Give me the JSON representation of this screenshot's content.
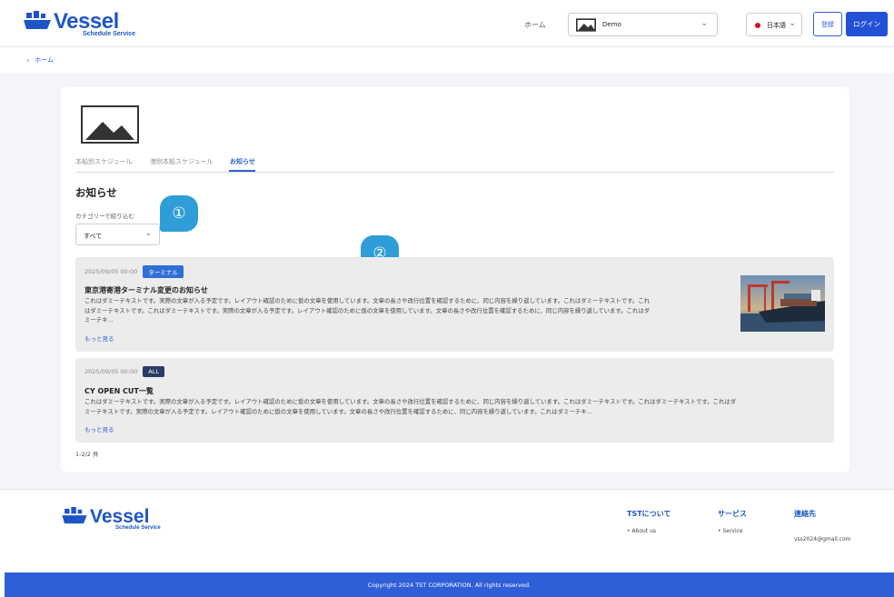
{
  "header": {
    "logo": {
      "title": "Vessel",
      "subtitle": "Schedule Service"
    },
    "nav_home": "ホーム",
    "company_select": {
      "value": "Demo"
    },
    "language_select": {
      "value": "日本語"
    },
    "register_label": "登録",
    "login_label": "ログイン"
  },
  "breadcrumb": {
    "back_icon": "chevron-left-icon",
    "label": "ホーム"
  },
  "tabs": [
    {
      "label": "本船別スケジュール",
      "active": false
    },
    {
      "label": "港別本船スケジュール",
      "active": false
    },
    {
      "label": "お知らせ",
      "active": true
    }
  ],
  "section": {
    "title": "お知らせ",
    "filter_label": "カテゴリーで絞り込む",
    "filter_value": "すべて"
  },
  "callouts": [
    "①",
    "②"
  ],
  "notices": [
    {
      "date": "2025/09/05 00:00",
      "badge": "ターミナル",
      "badge_color": "#2f6fd6",
      "title": "東京港寄港ターミナル変更のお知らせ",
      "body_lines": [
        "これはダミーテキストです。実際の文章が入る予定です。レイアウト確認のために仮の文章を使用しています。文章の長さや改行位置を確認するために、同じ内容を繰り返しています。これはダミーテキストです。これ",
        "はダミーテキストです。これはダミーテキストです。実際の文章が入る予定です。レイアウト確認のために仮の文章を使用しています。文章の長さや改行位置を確認するために、同じ内容を繰り返しています。これはダ",
        "ミーテキ..."
      ],
      "more_label": "もっと見る",
      "has_photo": true
    },
    {
      "date": "2025/09/05 00:00",
      "badge": "ALL",
      "badge_color": "#2b3a66",
      "title": "CY OPEN CUT一覧",
      "body_lines": [
        "これはダミーテキストです。実際の文章が入る予定です。レイアウト確認のために仮の文章を使用しています。文章の長さや改行位置を確認するために、同じ内容を繰り返しています。これはダミーテキストです。これはダミーテキストです。これはダ",
        "ミーテキストです。実際の文章が入る予定です。レイアウト確認のために仮の文章を使用しています。文章の長さや改行位置を確認するために、同じ内容を繰り返しています。これはダミーテキ..."
      ],
      "more_label": "もっと見る",
      "has_photo": false
    }
  ],
  "result_count": "1-2/2 件",
  "footer": {
    "logo": {
      "title": "Vessel",
      "subtitle": "Schedule Service"
    },
    "columns": [
      {
        "title": "TSTについて",
        "link": "About us"
      },
      {
        "title": "サービス",
        "link": "Service"
      },
      {
        "title": "連絡先",
        "link": "vss2024@gmail.com"
      }
    ],
    "copyright": "Copyright 2024 TST CORPORATION. All rights reserved."
  },
  "colors": {
    "brand_blue": "#1e55c4",
    "primary_button": "#2251d6",
    "callout": "#2f9ed8",
    "footer_bar": "#2f5fd8"
  }
}
